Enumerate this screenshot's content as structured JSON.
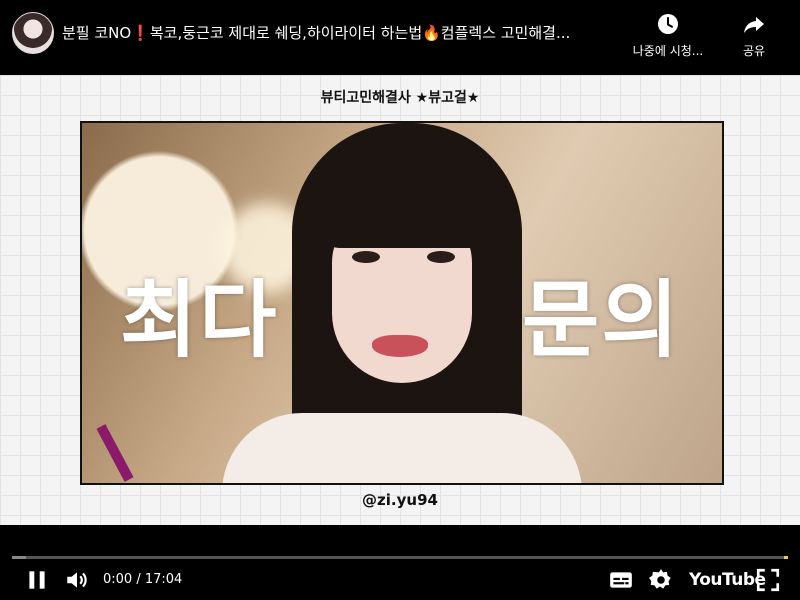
{
  "header": {
    "title": "분필 코NO❗️복코,둥근코 제대로 쉐딩,하이라이터 하는법🔥컴플렉스 고민해결...",
    "watch_later_label": "나중에 시청...",
    "share_label": "공유"
  },
  "video": {
    "banner": "뷰티고민해결사 ★뷰고걸★",
    "overlay_left": "최다",
    "overlay_right": "문의",
    "handle": "@zi.yu94"
  },
  "player": {
    "time": "0:00 / 17:04",
    "progress": 0,
    "logo": "YouTube",
    "icons": [
      "pause-icon",
      "volume-icon",
      "captions-icon",
      "settings-icon",
      "fullscreen-icon"
    ]
  },
  "colors": {
    "progress_played": "#ff0000",
    "progress_track": "#555555",
    "background": "#000000"
  }
}
